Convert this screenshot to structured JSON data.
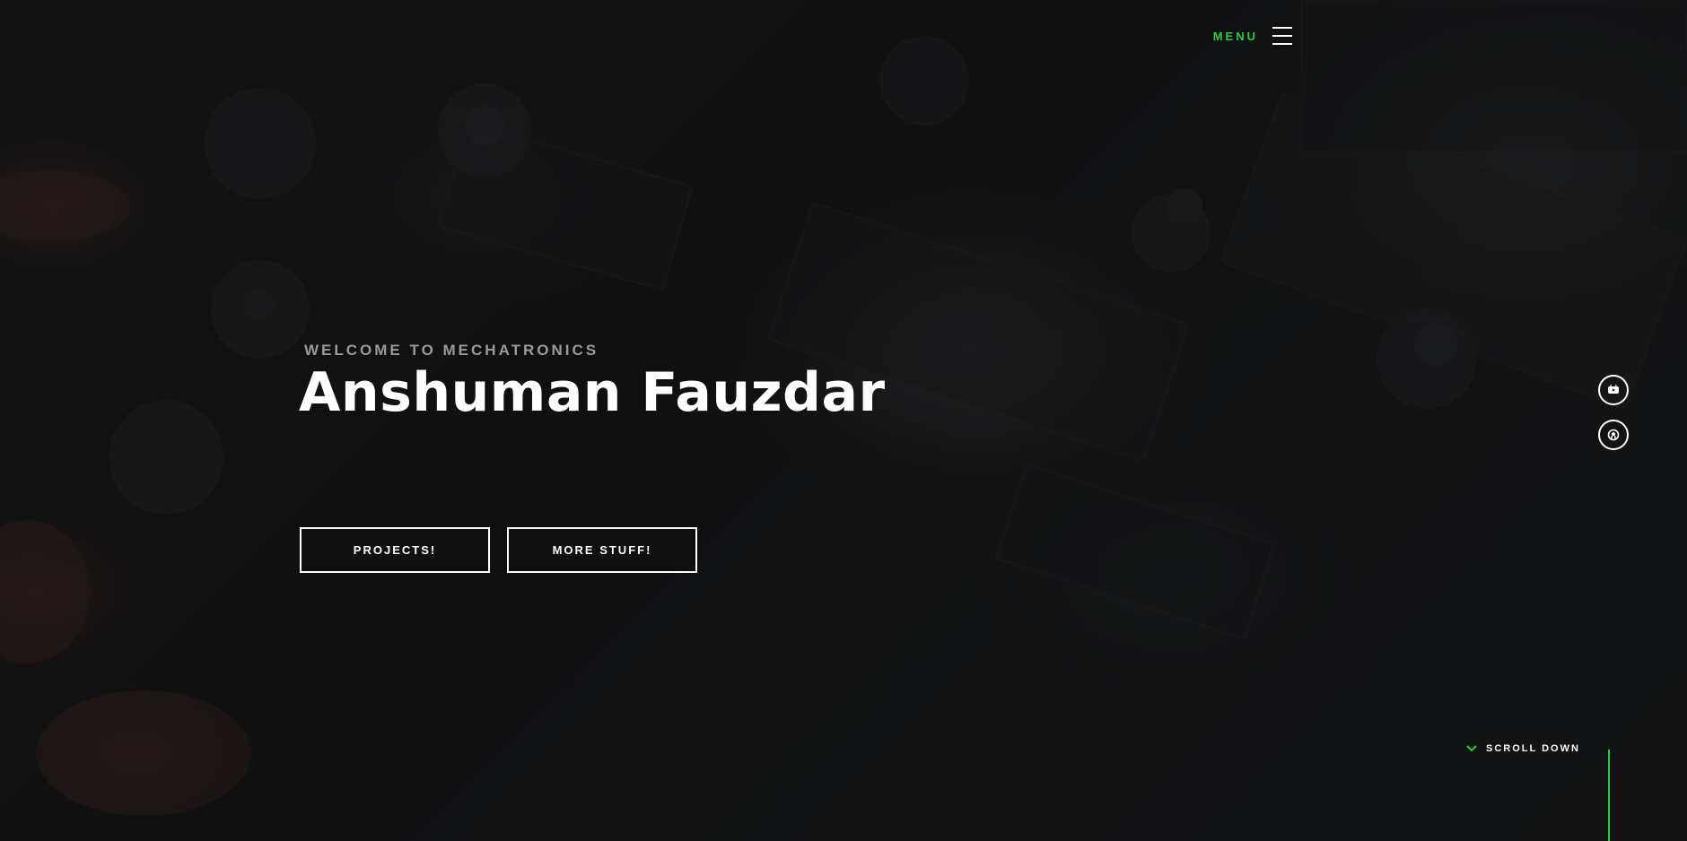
{
  "menu": {
    "label": "MENU",
    "icon": "hamburger-icon"
  },
  "hero": {
    "welcome": "WELCOME TO MECHATRONICS",
    "name": "Anshuman Fauzdar"
  },
  "buttons": {
    "projects": "PROJECTS!",
    "more": "MORE STUFF!"
  },
  "social": [
    {
      "icon": "youtube-icon"
    },
    {
      "icon": "github-icon"
    }
  ],
  "scroll": {
    "label": "SCROLL DOWN",
    "icon": "chevron-down-icon"
  },
  "colors": {
    "accent": "#2ecc40",
    "text": "#ffffff",
    "muted": "#9a9a9a"
  }
}
